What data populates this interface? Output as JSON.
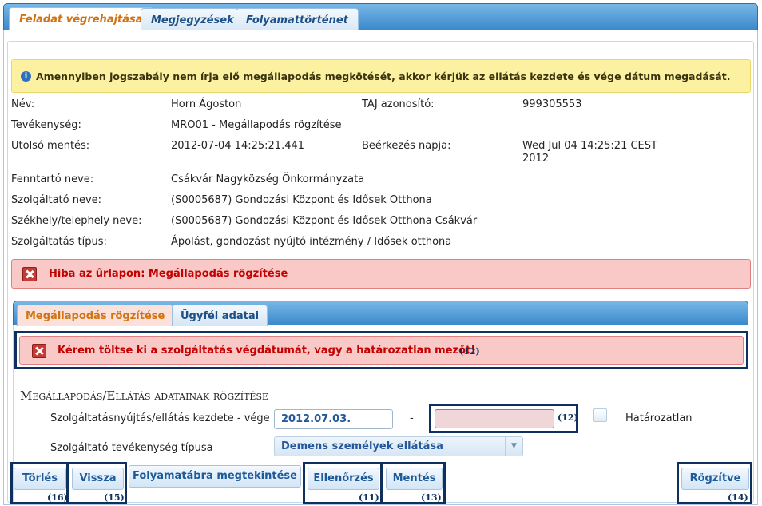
{
  "tabs": [
    "Feladat végrehajtása",
    "Megjegyzések",
    "Folyamattörténet"
  ],
  "info": {
    "icon": "info-icon",
    "text": "Amennyiben jogszabály nem írja elő megállapodás megkötését, akkor kérjük az ellátás kezdete és vége dátum megadását."
  },
  "details": {
    "nev_label": "Név:",
    "nev_value": "Horn Ágoston",
    "taj_label": "TAJ azonosító:",
    "taj_value": "999305553",
    "tevekenyseg_label": "Tevékenység:",
    "tevekenyseg_value": "MRO01 - Megállapodás rögzítése",
    "utolso_mentes_label": "Utolsó mentés:",
    "utolso_mentes_value": "2012-07-04 14:25:21.441",
    "beerkezes_label": "Beérkezés napja:",
    "beerkezes_value_line1": "Wed Jul 04 14:25:21 CEST",
    "beerkezes_value_line2": "2012",
    "fenntarto_label": "Fenntartó neve:",
    "fenntarto_value": "Csákvár Nagyközség Önkormányzata",
    "szolgaltato_label": "Szolgáltató neve:",
    "szolgaltato_value": "(S0005687) Gondozási Központ és Idősek Otthona",
    "szekhely_label": "Székhely/telephely neve:",
    "szekhely_value": "(S0005687) Gondozási Központ és Idősek Otthona Csákvár",
    "tipus_label": "Szolgáltatás típus:",
    "tipus_value": "Ápolást, gondozást nyújtó intézmény / Idősek otthona"
  },
  "form_error": "Hiba az űrlapon: Megállapodás rögzítése",
  "subtabs": [
    "Megállapodás rögzítése",
    "Ügyfél adatai"
  ],
  "field_error": "Kérem töltse ki a szolgáltatás végdátumát, vagy a határozatlan mezőt!",
  "field_error_annot": "(12)",
  "section_title": "Megállapodás/Ellátás adatainak rögzítése",
  "form": {
    "date_label": "Szolgáltatásnyújtás/ellátás kezdete - vége",
    "start_value": "2012.07.03.",
    "dash": "-",
    "end_value": "",
    "end_annot": "(12)",
    "hatarozatlan_label": "Határozatlan",
    "tevekenyseg_tipus_label": "Szolgáltató tevékenység típusa",
    "tevekenyseg_tipus_value": "Demens személyek ellátása"
  },
  "buttons": {
    "torles": "Törlés",
    "torles_annot": "(16)",
    "vissza": "Vissza",
    "vissza_annot": "(15)",
    "folyamatabra": "Folyamatábra megtekintése",
    "ellenorzes": "Ellenőrzés",
    "ellenorzes_annot": "(11)",
    "mentes": "Mentés",
    "mentes_annot": "(13)",
    "rogzitve": "Rögzítve",
    "rogzitve_annot": "(14)"
  },
  "colors": {
    "tab_active_text": "#d27313",
    "tab_bar": "#3b89cc",
    "info_bg": "#fcf1a0",
    "error_bg": "#f9c9c8",
    "error_text": "#c40000",
    "annotation_border": "#0f2f5c"
  }
}
